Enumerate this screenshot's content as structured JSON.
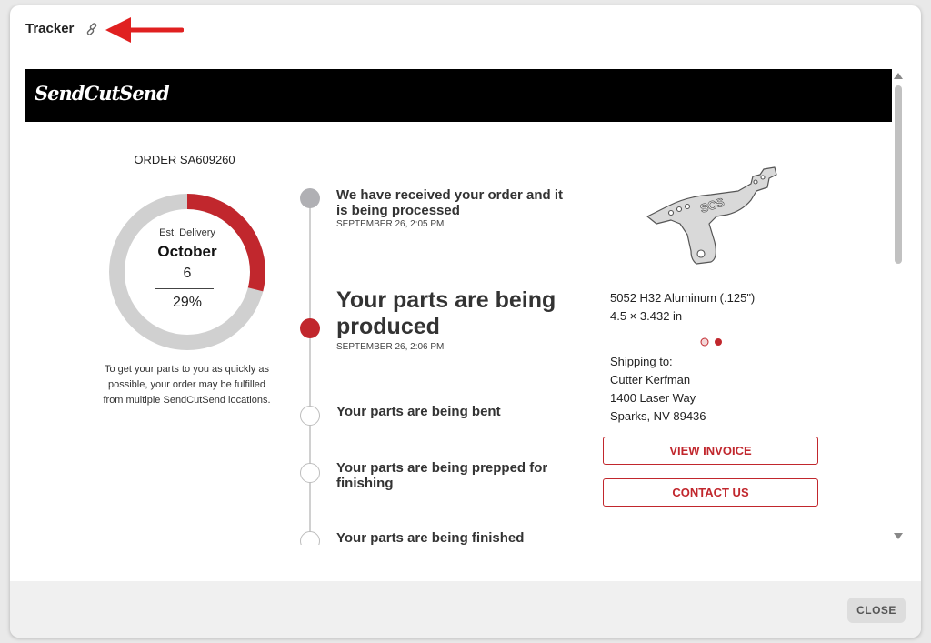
{
  "modal": {
    "title": "Tracker"
  },
  "brand": {
    "logo_text": "SendCutSend"
  },
  "order": {
    "number_label": "ORDER SA609260",
    "est_delivery_label": "Est. Delivery",
    "est_month": "October",
    "est_day": "6",
    "progress_percent_label": "29%",
    "progress_fraction": 0.29,
    "note": "To get your parts to you as quickly as possible, your order may be fulfilled from multiple SendCutSend locations."
  },
  "timeline": {
    "steps": [
      {
        "title": "We have received your order and it is being processed",
        "date": "SEPTEMBER 26, 2:05 PM",
        "status": "done"
      },
      {
        "title": "Your parts are being produced",
        "date": "SEPTEMBER 26, 2:06 PM",
        "status": "active"
      },
      {
        "title": "Your parts are being bent",
        "date": "",
        "status": "pending"
      },
      {
        "title": "Your parts are being prepped for finishing",
        "date": "",
        "status": "pending"
      },
      {
        "title": "Your parts are being finished",
        "date": "",
        "status": "pending"
      }
    ]
  },
  "part": {
    "engraving": "SCS",
    "material": "5052 H32 Aluminum (.125\")",
    "dimensions": "4.5 × 3.432 in"
  },
  "shipping": {
    "label": "Shipping to:",
    "name": "Cutter Kerfman",
    "street": "1400 Laser Way",
    "city": "Sparks, NV 89436"
  },
  "buttons": {
    "view_invoice": "VIEW INVOICE",
    "contact_us": "CONTACT US",
    "close": "CLOSE"
  },
  "colors": {
    "accent": "#c1272d",
    "track": "#d0d0d0",
    "done_dot": "#b0b0b4",
    "annotation_arrow": "#e02020"
  }
}
